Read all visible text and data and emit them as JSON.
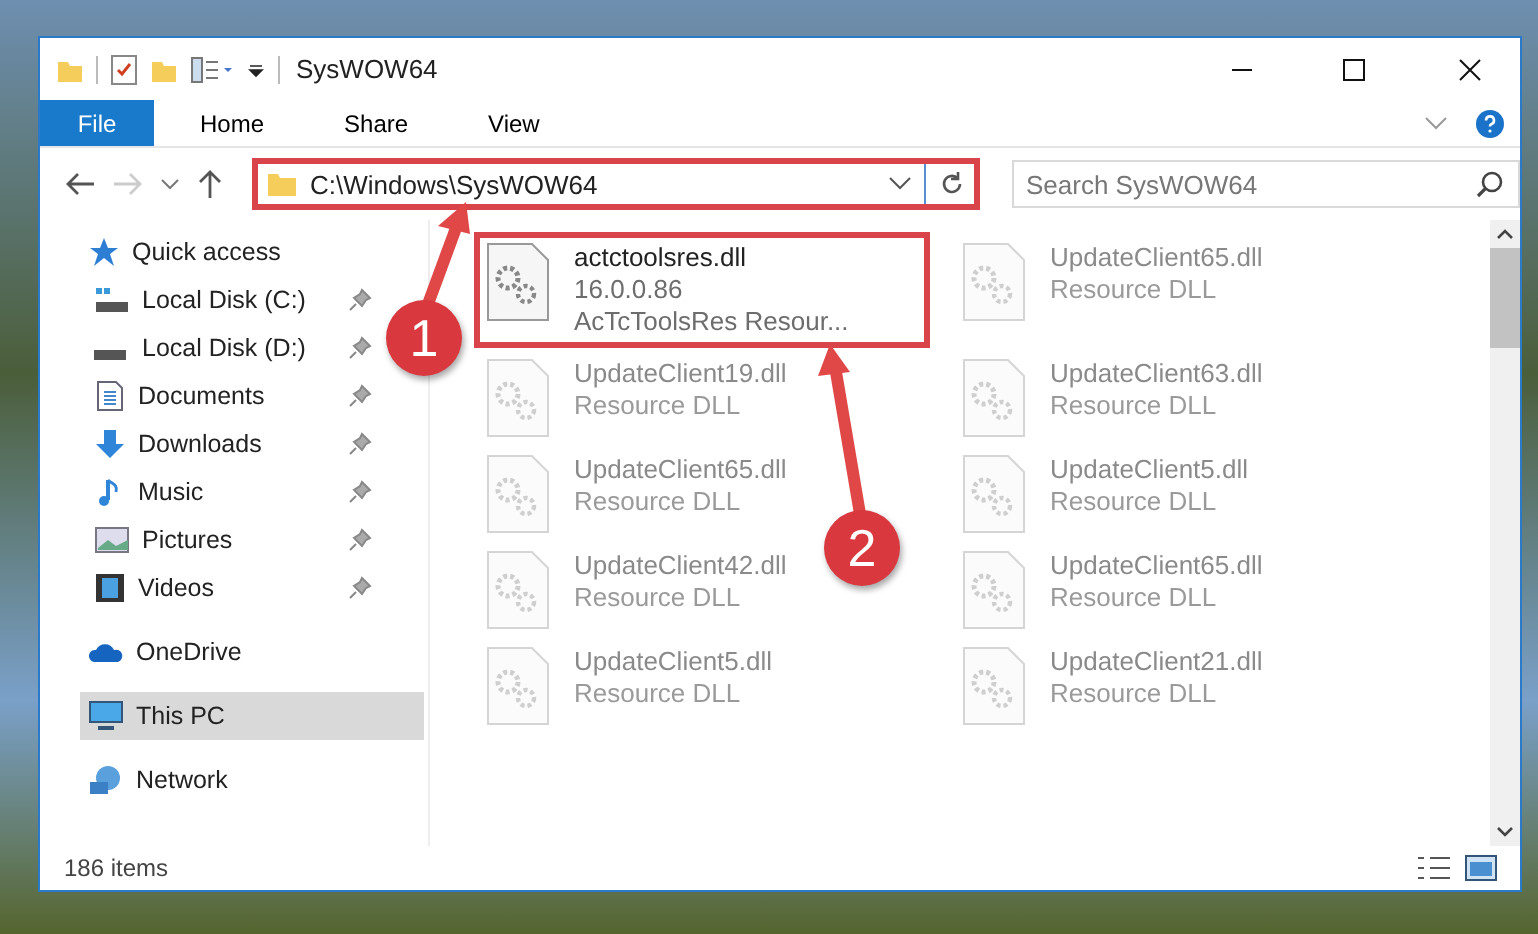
{
  "window": {
    "title": "SysWOW64"
  },
  "ribbon_tabs": [
    {
      "label": "File",
      "kind": "file-menu",
      "selected": false
    },
    {
      "label": "Home",
      "kind": "tab",
      "selected": false
    },
    {
      "label": "Share",
      "kind": "tab",
      "selected": false
    },
    {
      "label": "View",
      "kind": "tab",
      "selected": false
    }
  ],
  "address_bar": {
    "path": "C:\\Windows\\SysWOW64",
    "highlighted": true
  },
  "search": {
    "placeholder": "Search SysWOW64"
  },
  "sidebar": {
    "items": [
      {
        "label": "Quick access",
        "kind": "star",
        "selected": false,
        "children": [
          {
            "label": "Local Disk (C:)",
            "kind": "drive-system",
            "pinned": true,
            "selected": false
          },
          {
            "label": "Local Disk (D:)",
            "kind": "drive",
            "pinned": true,
            "selected": false
          },
          {
            "label": "Documents",
            "kind": "document",
            "pinned": true,
            "selected": false
          },
          {
            "label": "Downloads",
            "kind": "download",
            "pinned": true,
            "selected": false
          },
          {
            "label": "Music",
            "kind": "music",
            "pinned": true,
            "selected": false
          },
          {
            "label": "Pictures",
            "kind": "picture",
            "pinned": true,
            "selected": false
          },
          {
            "label": "Videos",
            "kind": "video",
            "pinned": true,
            "selected": false
          }
        ]
      },
      {
        "label": "OneDrive",
        "kind": "cloud",
        "selected": false
      },
      {
        "label": "This PC",
        "kind": "computer",
        "selected": true
      },
      {
        "label": "Network",
        "kind": "network",
        "selected": false
      }
    ]
  },
  "files": [
    {
      "name": "actctoolsres.dll",
      "lines": [
        "16.0.0.86",
        "AcTcToolsRes Resour..."
      ],
      "faded": false,
      "highlighted": true
    },
    {
      "name": "UpdateClient65.dll",
      "lines": [
        "Resource DLL"
      ],
      "faded": true,
      "highlighted": false
    },
    {
      "name": "UpdateClient19.dll",
      "lines": [
        "Resource DLL"
      ],
      "faded": true,
      "highlighted": false
    },
    {
      "name": "UpdateClient63.dll",
      "lines": [
        "Resource DLL"
      ],
      "faded": true,
      "highlighted": false
    },
    {
      "name": "UpdateClient65.dll",
      "lines": [
        "Resource DLL"
      ],
      "faded": true,
      "highlighted": false
    },
    {
      "name": "UpdateClient5.dll",
      "lines": [
        "Resource DLL"
      ],
      "faded": true,
      "highlighted": false
    },
    {
      "name": "UpdateClient42.dll",
      "lines": [
        "Resource DLL"
      ],
      "faded": true,
      "highlighted": false
    },
    {
      "name": "UpdateClient65.dll",
      "lines": [
        "Resource DLL"
      ],
      "faded": true,
      "highlighted": false
    },
    {
      "name": "UpdateClient5.dll",
      "lines": [
        "Resource DLL"
      ],
      "faded": true,
      "highlighted": false
    },
    {
      "name": "UpdateClient21.dll",
      "lines": [
        "Resource DLL"
      ],
      "faded": true,
      "highlighted": false
    }
  ],
  "status_bar": {
    "count": "186 items"
  },
  "step_markers": [
    "1",
    "2"
  ]
}
